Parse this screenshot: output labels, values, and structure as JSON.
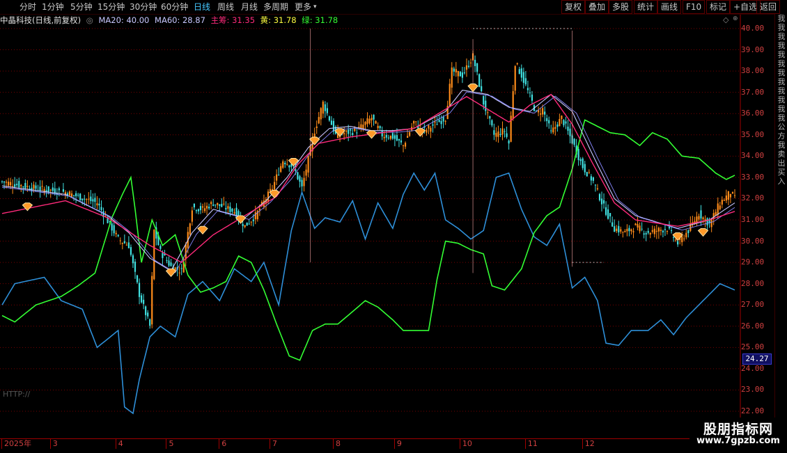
{
  "toolbar": {
    "periods": [
      {
        "label": "分时",
        "active": false
      },
      {
        "label": "1分钟",
        "active": false
      },
      {
        "label": "5分钟",
        "active": false
      },
      {
        "label": "15分钟",
        "active": false
      },
      {
        "label": "30分钟",
        "active": false
      },
      {
        "label": "60分钟",
        "active": false
      },
      {
        "label": "日线",
        "active": true
      },
      {
        "label": "周线",
        "active": false
      },
      {
        "label": "月线",
        "active": false
      },
      {
        "label": "多周期",
        "active": false
      },
      {
        "label": "更多",
        "active": false
      }
    ],
    "actions": [
      "复权",
      "叠加",
      "多股",
      "统计",
      "画线",
      "F10",
      "标记",
      "+自选",
      "返回"
    ]
  },
  "info": {
    "stock": "中晶科技(日线,前复权)",
    "ma20": "MA20: 40.00",
    "ma60": "MA60: 28.87",
    "main": "主筹: 31.35",
    "yellow": "黄: 31.78",
    "green": "绿: 31.78"
  },
  "colors": {
    "up": "#ff8c1a",
    "down": "#40e0e0",
    "ma20": "#c8c8ff",
    "main": "#ff2a7a",
    "blue_line": "#2e8fd8",
    "green_line": "#33ff33",
    "grid": "#7a0000",
    "axis": "#d04040"
  },
  "current_price": "24.27",
  "watermark": "HTTP://",
  "side_strip": "我我我我我我我我我我我我公方我卖出买入",
  "brand": {
    "title": "股朋指标网",
    "url": "www.7gpzb.com"
  },
  "month_labels": [
    "2025年",
    "3",
    "4",
    "5",
    "6",
    "7",
    "8",
    "9",
    "10",
    "11",
    "12"
  ],
  "chart_data": {
    "type": "line",
    "title": "中晶科技(日线,前复权)",
    "ylim": [
      22.0,
      40.3
    ],
    "y_ticks": [
      "40.00",
      "39.00",
      "38.00",
      "37.00",
      "36.00",
      "35.00",
      "34.00",
      "33.00",
      "32.00",
      "31.00",
      "30.00",
      "29.00",
      "28.00",
      "27.00",
      "26.00",
      "25.00",
      "24.00",
      "23.00",
      "22.00"
    ],
    "x_months": [
      "2025年",
      "3",
      "4",
      "5",
      "6",
      "7",
      "8",
      "9",
      "10",
      "11",
      "12"
    ],
    "price_keypoints": [
      [
        0,
        32.8
      ],
      [
        15,
        32.5
      ],
      [
        30,
        32.3
      ],
      [
        45,
        31.8
      ],
      [
        55,
        30.1
      ],
      [
        60,
        29.8
      ],
      [
        65,
        27.5
      ],
      [
        70,
        26.0
      ],
      [
        72,
        30.5
      ],
      [
        75,
        29.5
      ],
      [
        80,
        28.8
      ],
      [
        85,
        28.6
      ],
      [
        90,
        31.6
      ],
      [
        95,
        31.5
      ],
      [
        100,
        31.8
      ],
      [
        110,
        31.4
      ],
      [
        115,
        30.7
      ],
      [
        120,
        31.2
      ],
      [
        128,
        32.5
      ],
      [
        133,
        33.8
      ],
      [
        138,
        33.5
      ],
      [
        142,
        32.5
      ],
      [
        148,
        35.2
      ],
      [
        152,
        36.5
      ],
      [
        158,
        35.0
      ],
      [
        168,
        35.2
      ],
      [
        175,
        35.8
      ],
      [
        180,
        35.0
      ],
      [
        185,
        34.9
      ],
      [
        190,
        34.5
      ],
      [
        195,
        35.6
      ],
      [
        200,
        35.2
      ],
      [
        205,
        35.5
      ],
      [
        210,
        35.8
      ],
      [
        213,
        38.0
      ],
      [
        218,
        37.8
      ],
      [
        223,
        38.7
      ],
      [
        228,
        36.5
      ],
      [
        233,
        35.0
      ],
      [
        238,
        35.2
      ],
      [
        240,
        34.6
      ],
      [
        243,
        38.4
      ],
      [
        246,
        37.8
      ],
      [
        250,
        36.8
      ],
      [
        253,
        36.0
      ],
      [
        256,
        36.2
      ],
      [
        260,
        35.1
      ],
      [
        265,
        35.8
      ],
      [
        270,
        34.7
      ],
      [
        275,
        33.5
      ],
      [
        280,
        32.8
      ],
      [
        285,
        31.6
      ],
      [
        290,
        30.6
      ],
      [
        295,
        30.4
      ],
      [
        300,
        30.7
      ],
      [
        305,
        30.4
      ],
      [
        310,
        30.5
      ],
      [
        315,
        30.6
      ],
      [
        320,
        29.9
      ],
      [
        325,
        30.5
      ],
      [
        330,
        31.3
      ],
      [
        335,
        30.8
      ],
      [
        340,
        31.8
      ],
      [
        345,
        32.3
      ],
      [
        347,
        32.0
      ]
    ],
    "ma_keypoints": [
      [
        0,
        32.6
      ],
      [
        30,
        32.2
      ],
      [
        50,
        31.2
      ],
      [
        60,
        30.4
      ],
      [
        70,
        29.2
      ],
      [
        80,
        28.6
      ],
      [
        90,
        30.4
      ],
      [
        100,
        31.5
      ],
      [
        115,
        31.1
      ],
      [
        125,
        31.9
      ],
      [
        135,
        33.0
      ],
      [
        145,
        34.4
      ],
      [
        155,
        35.3
      ],
      [
        165,
        35.4
      ],
      [
        175,
        35.2
      ],
      [
        185,
        35.2
      ],
      [
        195,
        35.3
      ],
      [
        210,
        36.1
      ],
      [
        218,
        37.1
      ],
      [
        230,
        36.9
      ],
      [
        240,
        36.3
      ],
      [
        250,
        36.1
      ],
      [
        260,
        36.9
      ],
      [
        270,
        36.1
      ],
      [
        280,
        34.0
      ],
      [
        290,
        32.0
      ],
      [
        300,
        31.2
      ],
      [
        320,
        30.6
      ],
      [
        335,
        31.0
      ],
      [
        347,
        31.8
      ]
    ],
    "main_keypoints": [
      [
        0,
        31.3
      ],
      [
        30,
        31.9
      ],
      [
        50,
        31.1
      ],
      [
        70,
        29.8
      ],
      [
        85,
        29.0
      ],
      [
        100,
        30.3
      ],
      [
        115,
        31.2
      ],
      [
        130,
        32.1
      ],
      [
        140,
        33.6
      ],
      [
        150,
        34.6
      ],
      [
        165,
        34.9
      ],
      [
        180,
        35.1
      ],
      [
        195,
        35.3
      ],
      [
        210,
        36.2
      ],
      [
        220,
        36.8
      ],
      [
        230,
        36.2
      ],
      [
        240,
        35.6
      ],
      [
        250,
        36.4
      ],
      [
        260,
        36.9
      ],
      [
        270,
        35.5
      ],
      [
        280,
        33.6
      ],
      [
        290,
        31.8
      ],
      [
        300,
        31.0
      ],
      [
        320,
        30.7
      ],
      [
        335,
        31.0
      ],
      [
        347,
        31.4
      ]
    ],
    "blue_keypoints": [
      [
        0,
        27.0
      ],
      [
        6,
        28.0
      ],
      [
        20,
        28.3
      ],
      [
        28,
        27.2
      ],
      [
        38,
        26.8
      ],
      [
        45,
        25.0
      ],
      [
        55,
        25.8
      ],
      [
        58,
        22.2
      ],
      [
        62,
        21.9
      ],
      [
        65,
        23.5
      ],
      [
        70,
        25.5
      ],
      [
        75,
        26.0
      ],
      [
        82,
        25.5
      ],
      [
        88,
        27.5
      ],
      [
        95,
        28.1
      ],
      [
        103,
        27.2
      ],
      [
        110,
        28.7
      ],
      [
        118,
        28.1
      ],
      [
        124,
        29.0
      ],
      [
        131,
        27.0
      ],
      [
        137,
        30.5
      ],
      [
        142,
        32.3
      ],
      [
        148,
        30.6
      ],
      [
        153,
        31.1
      ],
      [
        160,
        30.9
      ],
      [
        166,
        31.9
      ],
      [
        172,
        30.1
      ],
      [
        178,
        31.8
      ],
      [
        185,
        30.6
      ],
      [
        190,
        32.2
      ],
      [
        195,
        33.2
      ],
      [
        200,
        32.4
      ],
      [
        205,
        33.2
      ],
      [
        210,
        31.0
      ],
      [
        216,
        30.6
      ],
      [
        222,
        30.1
      ],
      [
        228,
        30.5
      ],
      [
        234,
        33.0
      ],
      [
        240,
        33.2
      ],
      [
        246,
        31.5
      ],
      [
        252,
        30.2
      ],
      [
        258,
        29.8
      ],
      [
        264,
        30.8
      ],
      [
        270,
        27.8
      ],
      [
        276,
        28.3
      ],
      [
        282,
        27.2
      ],
      [
        286,
        25.2
      ],
      [
        292,
        25.1
      ],
      [
        298,
        25.8
      ],
      [
        306,
        25.8
      ],
      [
        312,
        26.3
      ],
      [
        318,
        25.6
      ],
      [
        324,
        26.4
      ],
      [
        332,
        27.2
      ],
      [
        340,
        28.0
      ],
      [
        347,
        27.7
      ]
    ],
    "green_keypoints": [
      [
        0,
        26.5
      ],
      [
        6,
        26.2
      ],
      [
        16,
        27.0
      ],
      [
        28,
        27.4
      ],
      [
        36,
        27.9
      ],
      [
        44,
        28.5
      ],
      [
        52,
        31.1
      ],
      [
        57,
        32.2
      ],
      [
        61,
        33.0
      ],
      [
        63,
        31.5
      ],
      [
        66,
        29.0
      ],
      [
        71,
        31.0
      ],
      [
        76,
        29.8
      ],
      [
        82,
        30.3
      ],
      [
        88,
        28.4
      ],
      [
        94,
        27.6
      ],
      [
        100,
        27.8
      ],
      [
        106,
        28.1
      ],
      [
        112,
        29.3
      ],
      [
        118,
        29.0
      ],
      [
        124,
        27.7
      ],
      [
        130,
        26.1
      ],
      [
        136,
        24.6
      ],
      [
        141,
        24.4
      ],
      [
        147,
        25.8
      ],
      [
        153,
        26.1
      ],
      [
        159,
        26.1
      ],
      [
        165,
        26.6
      ],
      [
        172,
        27.2
      ],
      [
        178,
        26.9
      ],
      [
        185,
        26.3
      ],
      [
        190,
        25.8
      ],
      [
        197,
        25.8
      ],
      [
        202,
        25.8
      ],
      [
        206,
        28.2
      ],
      [
        210,
        30.0
      ],
      [
        216,
        29.9
      ],
      [
        222,
        29.6
      ],
      [
        228,
        29.4
      ],
      [
        232,
        27.9
      ],
      [
        238,
        27.7
      ],
      [
        246,
        28.7
      ],
      [
        252,
        30.4
      ],
      [
        258,
        31.2
      ],
      [
        264,
        31.6
      ],
      [
        270,
        33.4
      ],
      [
        276,
        35.7
      ],
      [
        282,
        35.4
      ],
      [
        288,
        35.1
      ],
      [
        295,
        35.0
      ],
      [
        302,
        34.5
      ],
      [
        308,
        35.1
      ],
      [
        315,
        34.8
      ],
      [
        322,
        34.0
      ],
      [
        330,
        33.9
      ],
      [
        338,
        33.2
      ],
      [
        343,
        32.9
      ],
      [
        347,
        33.1
      ]
    ],
    "diamond_markers": [
      [
        12,
        31.6
      ],
      [
        80,
        28.5
      ],
      [
        95,
        30.5
      ],
      [
        113,
        31.0
      ],
      [
        129,
        32.2
      ],
      [
        138,
        33.7
      ],
      [
        148,
        34.7
      ],
      [
        160,
        35.1
      ],
      [
        175,
        35.0
      ],
      [
        198,
        35.1
      ],
      [
        223,
        37.2
      ],
      [
        320,
        30.2
      ],
      [
        332,
        30.4
      ]
    ],
    "vertical_markers": [
      [
        146,
        29.0,
        40.0
      ],
      [
        223,
        28.5,
        39.5
      ],
      [
        270,
        28.8,
        39.9
      ]
    ]
  }
}
